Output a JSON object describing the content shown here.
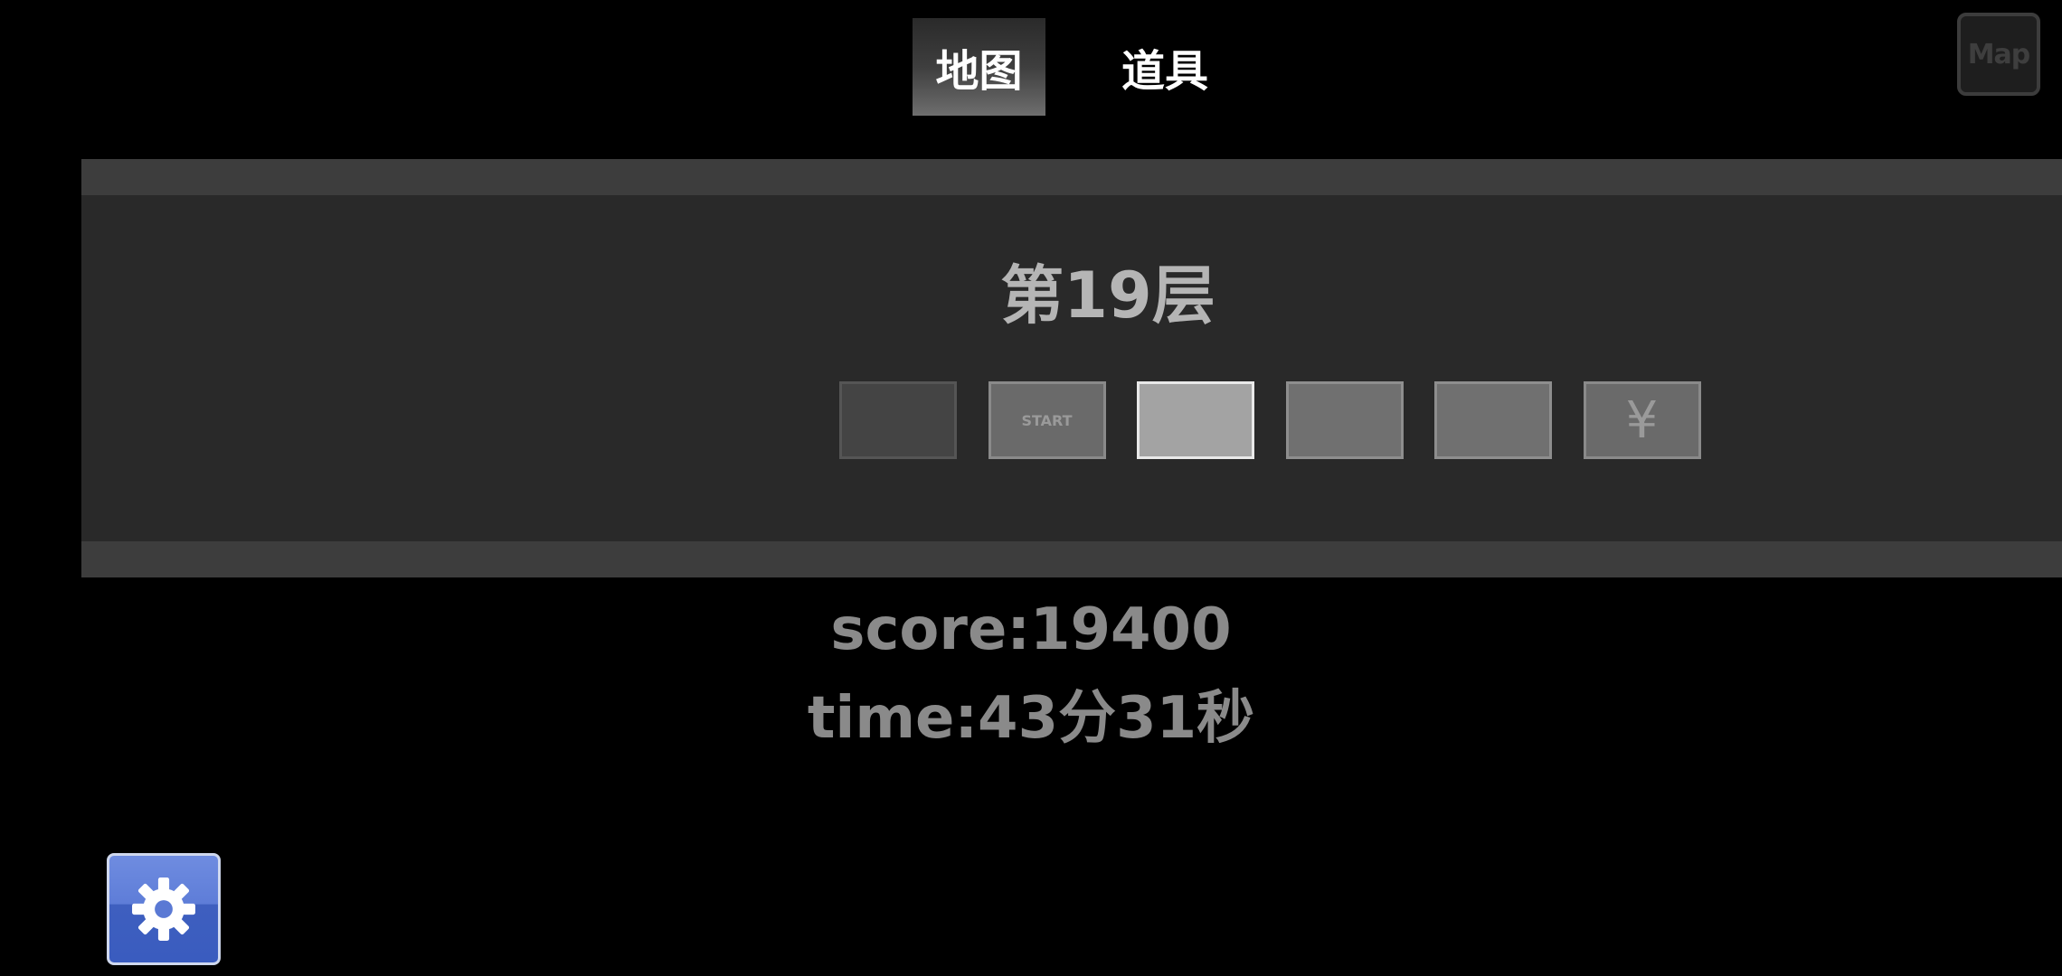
{
  "tabs": {
    "map_label": "地图",
    "items_label": "道具"
  },
  "map_button": {
    "label": "Map"
  },
  "floor": {
    "title": "第19层",
    "rooms": [
      {
        "label": "",
        "fill": "#444444",
        "border": "#555555"
      },
      {
        "label": "START",
        "fill": "#6a6a6a",
        "border": "#8a8a8a"
      },
      {
        "label": "",
        "fill": "#a3a3a3",
        "border": "#e8e8e8"
      },
      {
        "label": "",
        "fill": "#707070",
        "border": "#8e8e8e"
      },
      {
        "label": "",
        "fill": "#707070",
        "border": "#8e8e8e"
      },
      {
        "label": "¥",
        "fill": "#6a6a6a",
        "border": "#8a8a8a"
      }
    ]
  },
  "stats": {
    "score": "score:19400",
    "time": "time:43分31秒"
  },
  "icons": {
    "settings": "gear-icon"
  },
  "colors": {
    "background": "#000000",
    "panel": "#292929",
    "panel_band": "#3d3d3d",
    "settings_blue": "#5e7dd8"
  }
}
